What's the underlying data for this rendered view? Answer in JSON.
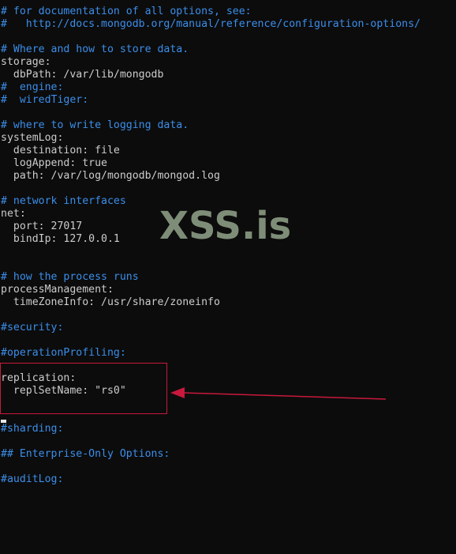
{
  "colors": {
    "background": "#0c0c0c",
    "text": "#cccccc",
    "comment": "#3b8eea",
    "highlight": "#c8193c",
    "watermark": "#9fb295"
  },
  "watermark": "XSS.is",
  "lines": [
    {
      "text": "# for documentation of all options, see:",
      "type": "comment"
    },
    {
      "text": "#   http://docs.mongodb.org/manual/reference/configuration-options/",
      "type": "comment"
    },
    {
      "text": "",
      "type": "normal"
    },
    {
      "text": "# Where and how to store data.",
      "type": "comment"
    },
    {
      "text": "storage:",
      "type": "normal"
    },
    {
      "text": "  dbPath: /var/lib/mongodb",
      "type": "normal"
    },
    {
      "text": "#  engine:",
      "type": "comment"
    },
    {
      "text": "#  wiredTiger:",
      "type": "comment"
    },
    {
      "text": "",
      "type": "normal"
    },
    {
      "text": "# where to write logging data.",
      "type": "comment"
    },
    {
      "text": "systemLog:",
      "type": "normal"
    },
    {
      "text": "  destination: file",
      "type": "normal"
    },
    {
      "text": "  logAppend: true",
      "type": "normal"
    },
    {
      "text": "  path: /var/log/mongodb/mongod.log",
      "type": "normal"
    },
    {
      "text": "",
      "type": "normal"
    },
    {
      "text": "# network interfaces",
      "type": "comment"
    },
    {
      "text": "net:",
      "type": "normal"
    },
    {
      "text": "  port: 27017",
      "type": "normal"
    },
    {
      "text": "  bindIp: 127.0.0.1",
      "type": "normal"
    },
    {
      "text": "",
      "type": "normal"
    },
    {
      "text": "",
      "type": "normal"
    },
    {
      "text": "# how the process runs",
      "type": "comment"
    },
    {
      "text": "processManagement:",
      "type": "normal"
    },
    {
      "text": "  timeZoneInfo: /usr/share/zoneinfo",
      "type": "normal"
    },
    {
      "text": "",
      "type": "normal"
    },
    {
      "text": "#security:",
      "type": "comment"
    },
    {
      "text": "",
      "type": "normal"
    },
    {
      "text": "#operationProfiling:",
      "type": "comment"
    },
    {
      "text": "",
      "type": "normal"
    },
    {
      "text": "replication:",
      "type": "normal"
    },
    {
      "text": "  replSetName: \"rs0\"",
      "type": "normal"
    },
    {
      "text": "",
      "type": "normal"
    },
    {
      "text": "",
      "type": "normal"
    },
    {
      "text": "#sharding:",
      "type": "comment"
    },
    {
      "text": "",
      "type": "normal"
    },
    {
      "text": "## Enterprise-Only Options:",
      "type": "comment"
    },
    {
      "text": "",
      "type": "normal"
    },
    {
      "text": "#auditLog:",
      "type": "comment"
    }
  ]
}
